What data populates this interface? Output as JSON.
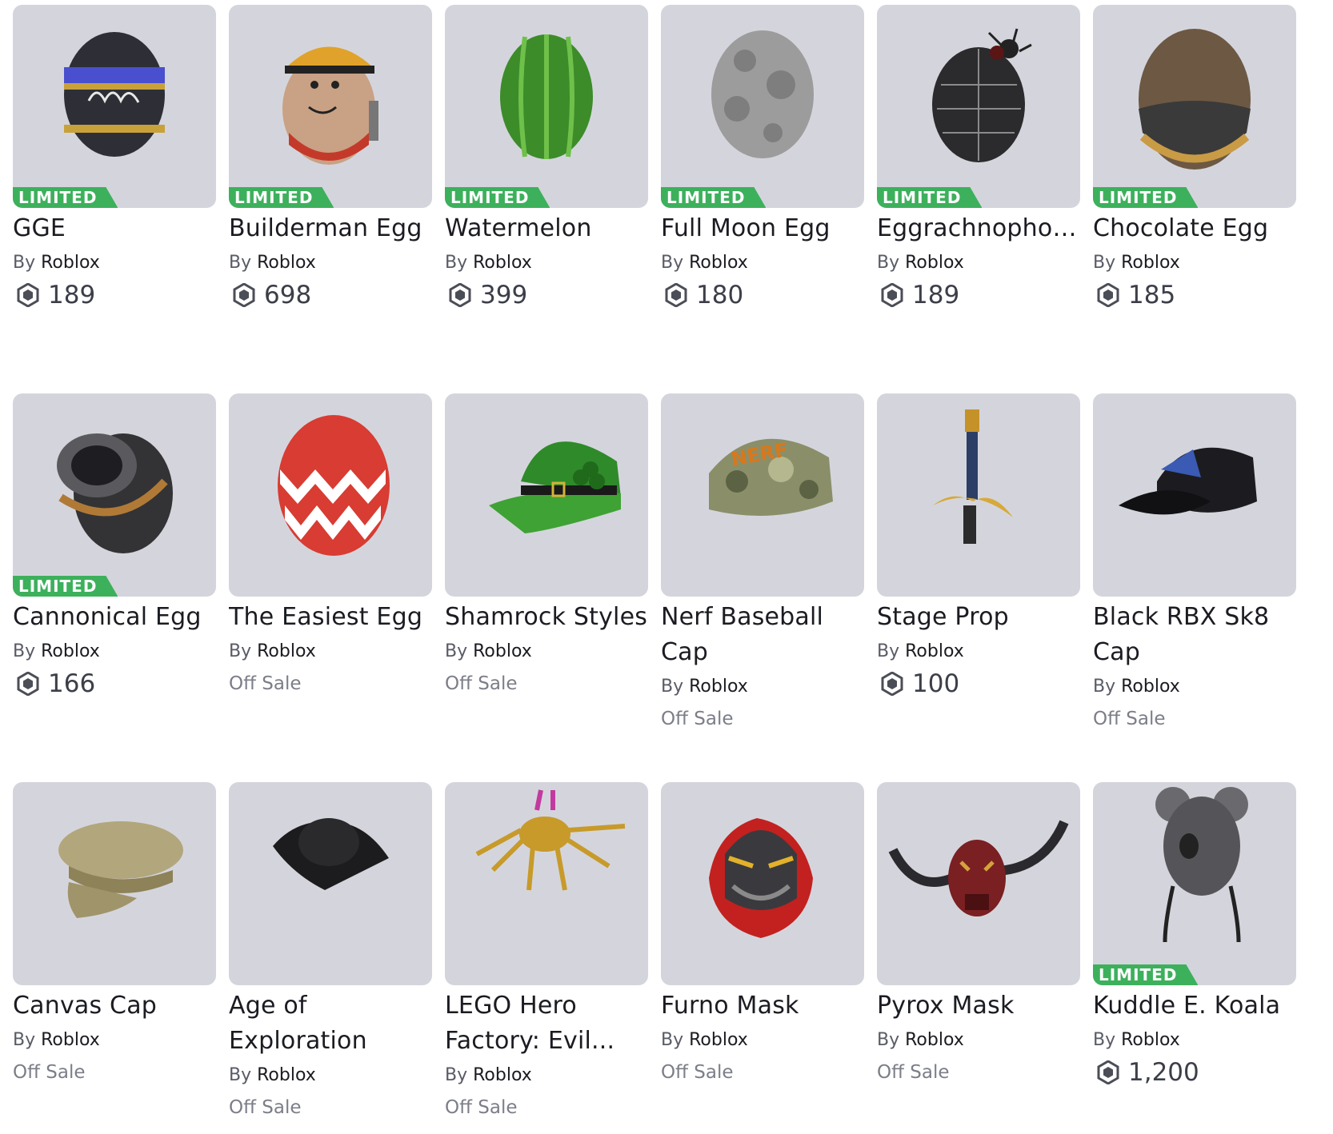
{
  "limited_label": "LIMITED",
  "by_label": "By",
  "colors": {
    "limited_badge": "#3db05c",
    "thumbnail_bg": "#d4d5dc"
  },
  "items": [
    {
      "name": "GGE",
      "creator": "Roblox",
      "price": "189",
      "limited": true,
      "off_sale": false,
      "icon": "striped-easter-egg-icon"
    },
    {
      "name": "Builderman Egg",
      "creator": "Roblox",
      "price": "698",
      "limited": true,
      "off_sale": false,
      "icon": "builderman-egg-icon"
    },
    {
      "name": "Watermelon",
      "creator": "Roblox",
      "price": "399",
      "limited": true,
      "off_sale": false,
      "icon": "watermelon-egg-icon"
    },
    {
      "name": "Full Moon Egg",
      "creator": "Roblox",
      "price": "180",
      "limited": true,
      "off_sale": false,
      "icon": "moon-egg-icon"
    },
    {
      "name": "Eggrachnophobia",
      "creator": "Roblox",
      "price": "189",
      "limited": true,
      "off_sale": false,
      "icon": "spider-egg-icon"
    },
    {
      "name": "Chocolate Egg",
      "creator": "Roblox",
      "price": "185",
      "limited": true,
      "off_sale": false,
      "icon": "chocolate-egg-icon"
    },
    {
      "name": "Cannonical Egg",
      "creator": "Roblox",
      "price": "166",
      "limited": true,
      "off_sale": false,
      "icon": "cannon-egg-icon"
    },
    {
      "name": "The Easiest Egg",
      "creator": "Roblox",
      "price": "Off Sale",
      "limited": false,
      "off_sale": true,
      "icon": "zigzag-egg-icon"
    },
    {
      "name": "Shamrock Styles",
      "creator": "Roblox",
      "price": "Off Sale",
      "limited": false,
      "off_sale": true,
      "icon": "shamrock-cap-icon"
    },
    {
      "name": "Nerf Baseball Cap",
      "creator": "Roblox",
      "price": "Off Sale",
      "limited": false,
      "off_sale": true,
      "icon": "camo-cap-icon"
    },
    {
      "name": "Stage Prop",
      "creator": "Roblox",
      "price": "100",
      "limited": false,
      "off_sale": false,
      "icon": "sword-icon"
    },
    {
      "name": "Black RBX Sk8 Cap",
      "creator": "Roblox",
      "price": "Off Sale",
      "limited": false,
      "off_sale": true,
      "icon": "black-cap-icon"
    },
    {
      "name": "Canvas Cap",
      "creator": "Roblox",
      "price": "Off Sale",
      "limited": false,
      "off_sale": true,
      "icon": "canvas-cap-icon"
    },
    {
      "name": "Age of Exploration",
      "creator": "Roblox",
      "price": "Off Sale",
      "limited": false,
      "off_sale": true,
      "icon": "tricorn-hat-icon"
    },
    {
      "name": "LEGO Hero Factory: Evil...",
      "creator": "Roblox",
      "price": "Off Sale",
      "limited": false,
      "off_sale": true,
      "icon": "spider-creature-icon"
    },
    {
      "name": "Furno Mask",
      "creator": "Roblox",
      "price": "Off Sale",
      "limited": false,
      "off_sale": true,
      "icon": "furno-mask-icon"
    },
    {
      "name": "Pyrox Mask",
      "creator": "Roblox",
      "price": "Off Sale",
      "limited": false,
      "off_sale": true,
      "icon": "horned-mask-icon"
    },
    {
      "name": "Kuddle E. Koala",
      "creator": "Roblox",
      "price": "1,200",
      "limited": true,
      "off_sale": false,
      "icon": "koala-hat-icon"
    }
  ]
}
